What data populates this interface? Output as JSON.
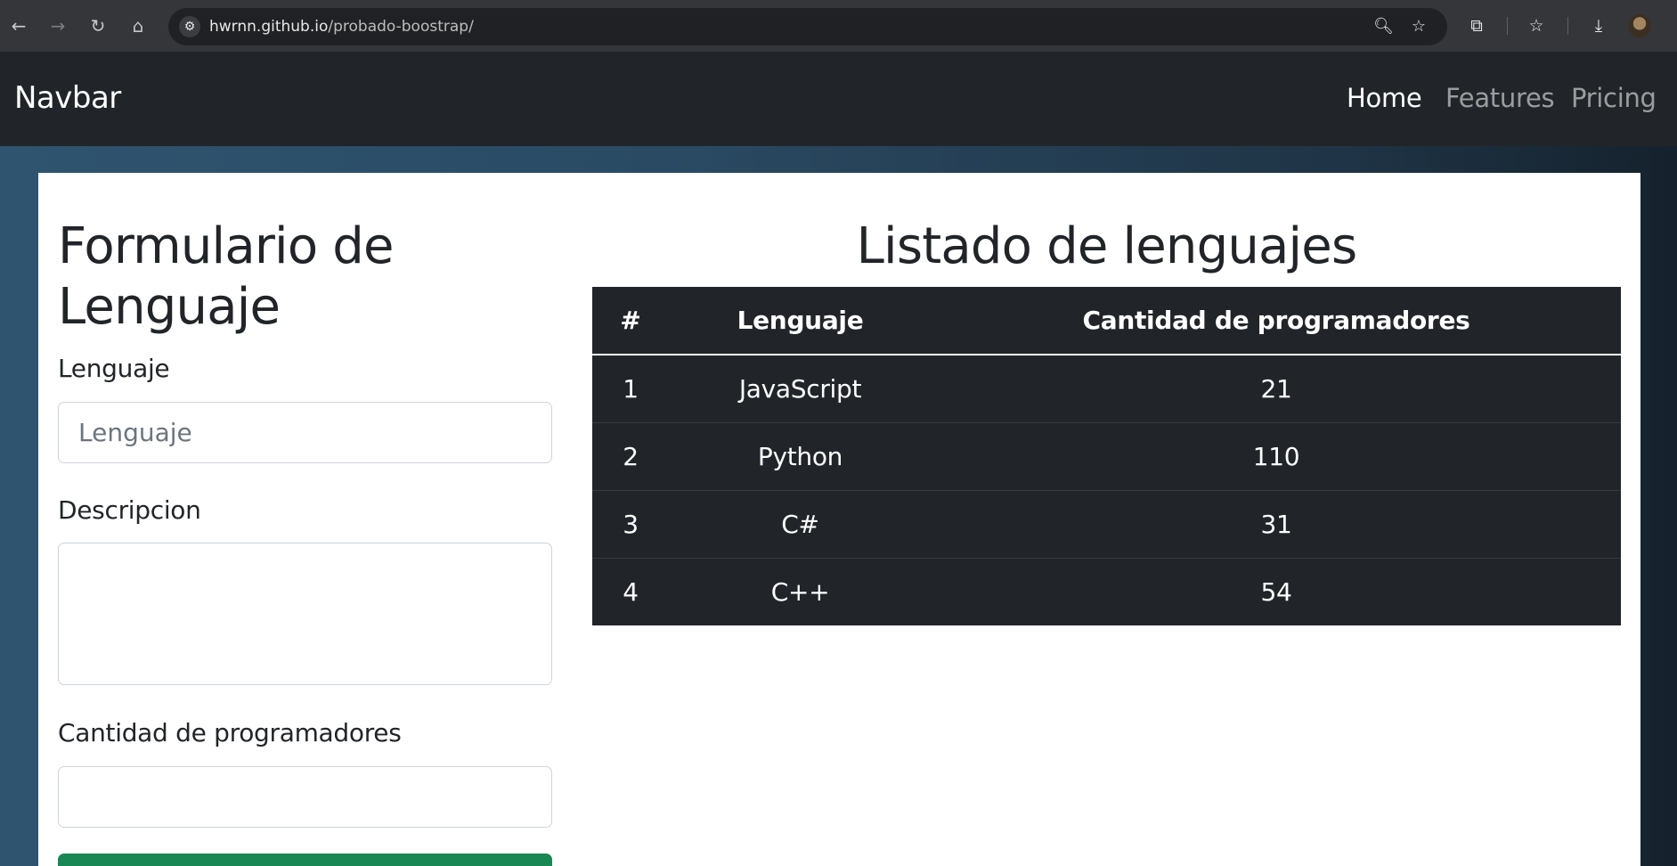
{
  "browser": {
    "url_host": "hwrnn.github.io",
    "url_path": "/probado-boostrap/",
    "icons": [
      "back-arrow-icon",
      "forward-arrow-icon",
      "reload-icon",
      "home-icon",
      "site-info-icon",
      "zoom-icon",
      "bookmark-star-icon",
      "extensions-icon",
      "favorites-icon",
      "download-icon",
      "profile-avatar"
    ]
  },
  "navbar": {
    "brand": "Navbar",
    "links": [
      {
        "label": "Home",
        "active": true
      },
      {
        "label": "Features",
        "active": false
      },
      {
        "label": "Pricing",
        "active": false
      }
    ]
  },
  "form": {
    "title": "Formulario de Lenguaje",
    "language_label": "Lenguaje",
    "language_placeholder": "Lenguaje",
    "language_value": "",
    "description_label": "Descripcion",
    "description_value": "",
    "programmers_label": "Cantidad de programadores",
    "programmers_value": "",
    "submit_color": "#198754"
  },
  "list": {
    "title": "Listado de lenguajes",
    "headers": [
      "#",
      "Lenguaje",
      "Cantidad de programadores"
    ],
    "rows": [
      {
        "num": "1",
        "language": "JavaScript",
        "count": "21"
      },
      {
        "num": "2",
        "language": "Python",
        "count": "110"
      },
      {
        "num": "3",
        "language": "C#",
        "count": "31"
      },
      {
        "num": "4",
        "language": "C++",
        "count": "54"
      }
    ]
  },
  "colors": {
    "navbar_bg": "#212529",
    "table_bg": "#212529",
    "page_gradient": [
      "#2f5470",
      "#15222d"
    ]
  }
}
